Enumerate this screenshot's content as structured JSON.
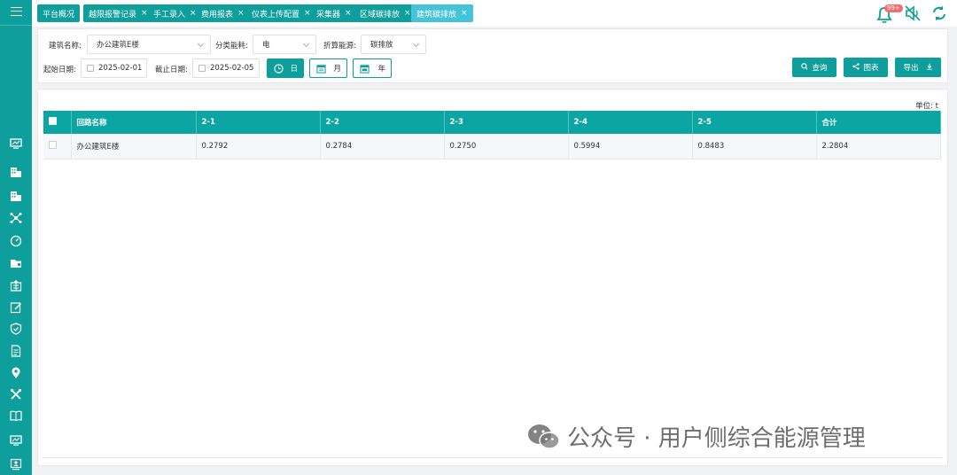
{
  "tabs": [
    {
      "label": "平台概况",
      "closable": false,
      "active": false
    },
    {
      "label": "越限报警记录",
      "closable": true,
      "active": false
    },
    {
      "label": "手工录入",
      "closable": true,
      "active": false
    },
    {
      "label": "费用报表",
      "closable": true,
      "active": false
    },
    {
      "label": "仪表上传配置",
      "closable": true,
      "active": false
    },
    {
      "label": "采集器",
      "closable": true,
      "active": false
    },
    {
      "label": "区域碳排放",
      "closable": true,
      "active": false
    },
    {
      "label": "建筑碳排放",
      "closable": true,
      "active": true
    }
  ],
  "tab_close": "×",
  "notifications": {
    "badge": "99+"
  },
  "filters": {
    "building_label": "建筑名称:",
    "building_value": "办公建筑E楼",
    "category_label": "分类能耗:",
    "category_value": "电",
    "convert_label": "折算能源:",
    "convert_value": "碳排放",
    "start_label": "起始日期:",
    "start_value": "2025-02-01",
    "end_label": "截止日期:",
    "end_value": "2025-02-05",
    "seg_day": "日",
    "seg_month": "月",
    "seg_year": "年",
    "query_label": "查询",
    "chart_label": "图表",
    "export_label": "导出"
  },
  "table": {
    "unit_label": "单位: t",
    "headers": [
      "回路名称",
      "2-1",
      "2-2",
      "2-3",
      "2-4",
      "2-5",
      "合计"
    ],
    "rows": [
      {
        "name": "办公建筑E楼",
        "values": [
          "0.2792",
          "0.2784",
          "0.2750",
          "0.5994",
          "0.8483",
          "2.2804"
        ]
      }
    ]
  },
  "watermark": {
    "text": "公众号 · 用户侧综合能源管理"
  },
  "colors": {
    "primary": "#0e9e9b",
    "active_tab": "#45c3d9",
    "badge": "#f56c6c",
    "header_row": "#0ba6a3"
  }
}
